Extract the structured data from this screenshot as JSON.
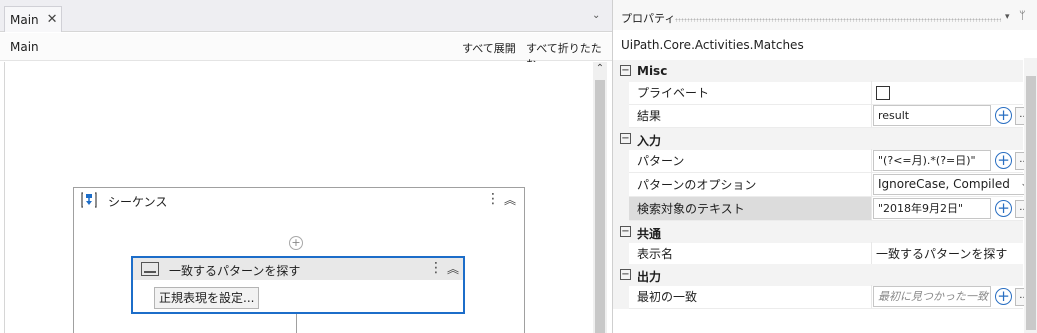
{
  "designer": {
    "tab_label": "Main",
    "tab_close_glyph": "✕",
    "tab_dropdown_glyph": "⌄",
    "breadcrumb": "Main",
    "expand_all": "すべて展開",
    "collapse_all": "すべて折りたたむ",
    "scroll_up_glyph": "⌃",
    "sequence": {
      "title": "シーケンス",
      "menu_glyph": "⋮",
      "collapse_glyph": "︽",
      "add_glyph": "+"
    },
    "activity": {
      "title": "一致するパターンを探す",
      "menu_glyph": "⋮",
      "collapse_glyph": "︽",
      "button_label": "正規表現を設定..."
    }
  },
  "properties": {
    "title": "プロパティ",
    "dropdown_glyph": "▾",
    "pin_glyph": "ᛘ",
    "class_name": "UiPath.Core.Activities.Matches",
    "categories": {
      "misc": {
        "label": "Misc",
        "toggle": "−"
      },
      "input": {
        "label": "入力",
        "toggle": "−"
      },
      "common": {
        "label": "共通",
        "toggle": "−"
      },
      "output": {
        "label": "出力",
        "toggle": "−"
      }
    },
    "rows": {
      "private": {
        "name": "プライベート",
        "checked": false
      },
      "result": {
        "name": "結果",
        "value": "result"
      },
      "pattern": {
        "name": "パターン",
        "value": "\"(?<=月).*(?=日)\""
      },
      "pattern_options": {
        "name": "パターンのオプション",
        "value": "IgnoreCase, Compiled",
        "chevron": "⌄"
      },
      "input_text": {
        "name": "検索対象のテキスト",
        "value": "\"2018年9月2日\""
      },
      "display_name": {
        "name": "表示名",
        "value": "一致するパターンを探す"
      },
      "first_match": {
        "name": "最初の一致",
        "placeholder": "最初に見つかった一致を..."
      }
    },
    "plus_glyph": "+",
    "dots_glyph": "..."
  },
  "colors": {
    "selection_border": "#1c6dc9",
    "plus_button": "#2a6fc2",
    "selected_row": "#dcdcdc"
  }
}
